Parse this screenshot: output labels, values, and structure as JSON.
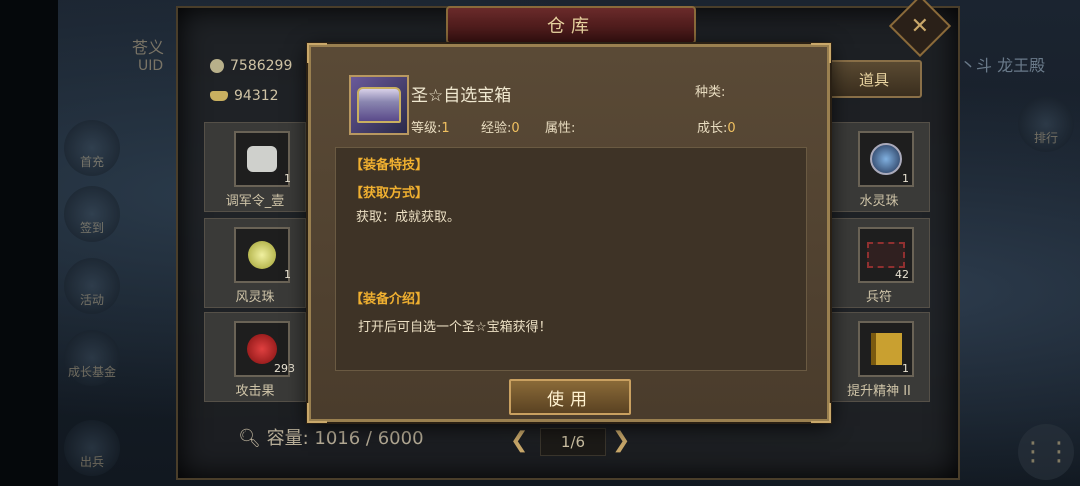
{
  "window": {
    "title": "仓库"
  },
  "player": {
    "label_partial": "苍义",
    "uid_label": "UID"
  },
  "currency": {
    "coins": "7586299",
    "ingots": "94312"
  },
  "top_right_text": "丶斗 龙王殿",
  "category_tab": "道具",
  "left_sidebar": [
    "首充",
    "签到",
    "活动",
    "成长基金",
    "出兵"
  ],
  "right_sidebar": [
    "排行"
  ],
  "inventory_left": [
    {
      "name": "调军令_壹",
      "qty": "1",
      "icon": "token-icon"
    },
    {
      "name": "风灵珠",
      "qty": "1",
      "icon": "wind-orb-icon"
    },
    {
      "name": "攻击果",
      "qty": "293",
      "icon": "attack-fruit-icon"
    }
  ],
  "inventory_right": [
    {
      "name": "水灵珠",
      "qty": "1",
      "icon": "water-orb-icon"
    },
    {
      "name": "兵符",
      "qty": "42",
      "icon": "army-tally-icon"
    },
    {
      "name": "提升精神 II",
      "qty": "1",
      "icon": "book-icon"
    }
  ],
  "capacity": {
    "label": "容量:",
    "value": "1016 / 6000"
  },
  "pager": {
    "text": "1/6"
  },
  "modal": {
    "item_name": "圣☆自选宝箱",
    "type_label": "种类:",
    "level_label": "等级:",
    "level_value": "1",
    "exp_label": "经验:",
    "exp_value": "0",
    "attr_label": "属性:",
    "growth_label": "成长:",
    "growth_value": "0",
    "sections": {
      "skill_title": "【装备特技】",
      "obtain_title": "【获取方式】",
      "obtain_text": "获取：成就获取。",
      "intro_title": "【装备介绍】",
      "intro_text": "打开后可自选一个圣☆宝箱获得！"
    },
    "use_button": "使用"
  },
  "colors": {
    "accent_gold": "#f0b030",
    "title_red": "#6a2a2a",
    "frame": "#9a8050"
  }
}
